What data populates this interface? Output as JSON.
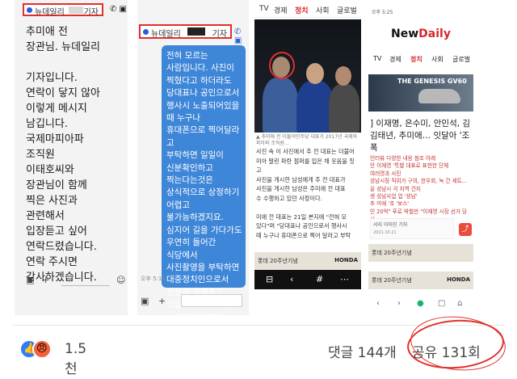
{
  "panel1": {
    "sender_name": "뉴데일리",
    "sender_tag": "기자",
    "message": "추미애 전\n장관님. 뉴데일리\n\n기자입니다.\n연락이 닿지 않아\n이렇게 메시지\n남깁니다.\n국제마피아파\n조직원\n이태호씨와\n장관님이 함께\n찍은 사진과\n관련해서\n입장듣고 싶어\n연락드렸습니다.\n연락 주시면\n감사하겠습니다.",
    "icons": [
      "phone-icon",
      "video-icon"
    ],
    "bottom_icons": [
      "camera-icon",
      "plus-icon",
      "sticker-icon"
    ]
  },
  "panel2": {
    "sender_name": "뉴데일리",
    "sender_tag": "기자",
    "bubble_color": "#3e86d8",
    "message": "전혀 모르는\n사람입니다. 사진이\n찍혔다고 하더라도\n당대표나 공인으로서\n행사시 노출되어있을\n때 누구나\n휴대폰으로 찍어달라고\n부탁하면 일일이\n신분확인하고\n찍는다는것은\n상식적으로 상정하기\n어렵고\n불가능하겠지요.\n심지어 길을 가다가도\n우연히 들어간\n식당에서\n사진촬영을 부탁하면\n대중정치인으로서\n선선히 응해주고\n있습니다. 상식적인\n눈으로 보시면 될\n문제입니다.",
    "time": "오후 5:14",
    "bottom_icons": [
      "camera-icon",
      "plus-icon",
      "sticker-icon"
    ]
  },
  "panel3": {
    "nav": [
      "TV",
      "경제",
      "정치",
      "사회",
      "글로벌"
    ],
    "caption": "▲ 추미애 전 더불어민주당 대표가 2017년 국제마피아파 조직원...",
    "body": "사진 속 이 사진에서 추 전 대표는 더불어\n미아 말린 파란 점퍼를 입은 채 웃음을 짓고\n사진을 게시한 남성에게 추 전 대표가\n사진을 게시한 남성은 추미애 전 대표\n수 수행하고 있던 사정이다.\n\n미애 전 대표는 21일 본지에 \"전혀 모\n있다\"며 \"당대표나 공인으로서 행사시\n때 누구나 휴대폰으로 찍어 달라고 부탁",
    "ad_text": "롯데 20주년기념",
    "ad_brand": "HONDA",
    "bottom_icons": [
      "menu-icon",
      "back-icon",
      "hashtag-icon",
      "more-icon"
    ]
  },
  "panel4": {
    "status": "오후 5:25",
    "logo_main": "New",
    "logo_accent": "Daily",
    "nav": [
      "TV",
      "경제",
      "정치",
      "사회",
      "글로벌"
    ],
    "nav_active": "정치",
    "banner_text": "THE GENESIS GV60",
    "headline": "] 이재명, 은수미, 안민석, 김\n김태년, 추미애… 잇달아 '조폭",
    "red_list": "인터뷰 다양한 내용 참조 아래\n안 이재명 '특별 대표로 표현한 단체\n여러명과 사진\n성남시장 직위가 구의, 한우회, 녹 간 세트...\n을 성남시 각 지역 건지\n생 성남사업 업 '성남'\n추 미애 '조 '보스'\n인 20억\" 푸로 박철만 \"이재명 시장 선거 당시",
    "byline": "서지 이미진 기자",
    "date": "2021.10.21",
    "ad_text": "롯데 20주년기념",
    "ad_brand": "HONDA",
    "bottom_icons": [
      "back-icon",
      "forward-icon",
      "home-icon",
      "tab-icon",
      "more-icon"
    ]
  },
  "footer": {
    "reaction_count": "1.5천",
    "comments_label": "댓글 144개",
    "shares_label": "공유 131회",
    "highlight_color": "#e0302a"
  }
}
